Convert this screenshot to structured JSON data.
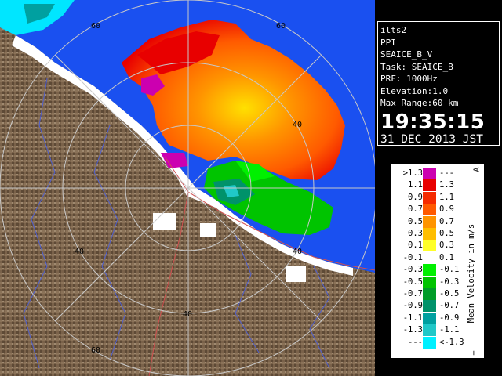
{
  "info": {
    "site": "ilts2",
    "mode": "PPI",
    "product": "SEAICE_B_V",
    "task": "Task: SEAICE_B",
    "prf": "PRF: 1000Hz",
    "elevation": "Elevation:1.0",
    "max_range": "Max Range:60 km",
    "time": "19:35:15",
    "date": "31 DEC 2013 JST"
  },
  "rings": {
    "labels": [
      "40",
      "60",
      "40",
      "60",
      "40",
      "40",
      "60"
    ]
  },
  "legend": {
    "title": "Mean Velocity in m/s",
    "corner_top": "A",
    "corner_bottom": "T",
    "rows": [
      {
        "lo": ">1.3",
        "hi": "---",
        "color": "#cc00b0"
      },
      {
        "lo": "1.1",
        "hi": "1.3",
        "color": "#e80000"
      },
      {
        "lo": "0.9",
        "hi": "1.1",
        "color": "#f52a00"
      },
      {
        "lo": "0.7",
        "hi": "0.9",
        "color": "#ff5a00"
      },
      {
        "lo": "0.5",
        "hi": "0.7",
        "color": "#ff9400"
      },
      {
        "lo": "0.3",
        "hi": "0.5",
        "color": "#ffbe00"
      },
      {
        "lo": "0.1",
        "hi": "0.3",
        "color": "#ffff28"
      },
      {
        "lo": "-0.1",
        "hi": "0.1",
        "color": "#ffffff"
      },
      {
        "lo": "-0.3",
        "hi": "-0.1",
        "color": "#00f000"
      },
      {
        "lo": "-0.5",
        "hi": "-0.3",
        "color": "#00c400"
      },
      {
        "lo": "-0.7",
        "hi": "-0.5",
        "color": "#009c28"
      },
      {
        "lo": "-0.9",
        "hi": "-0.7",
        "color": "#00926a"
      },
      {
        "lo": "-1.1",
        "hi": "-0.9",
        "color": "#00a0a0"
      },
      {
        "lo": "-1.3",
        "hi": "-1.1",
        "color": "#20c8c8"
      },
      {
        "lo": "---",
        "hi": "<-1.3",
        "color": "#00f0ff"
      }
    ]
  },
  "colors": {
    "sea": "#1a50f0",
    "land": "#7c6448",
    "coast_ice": "#ffffff",
    "range_rings": "#c8c8c8",
    "roads": "#d05050",
    "rivers": "#5060d0"
  }
}
